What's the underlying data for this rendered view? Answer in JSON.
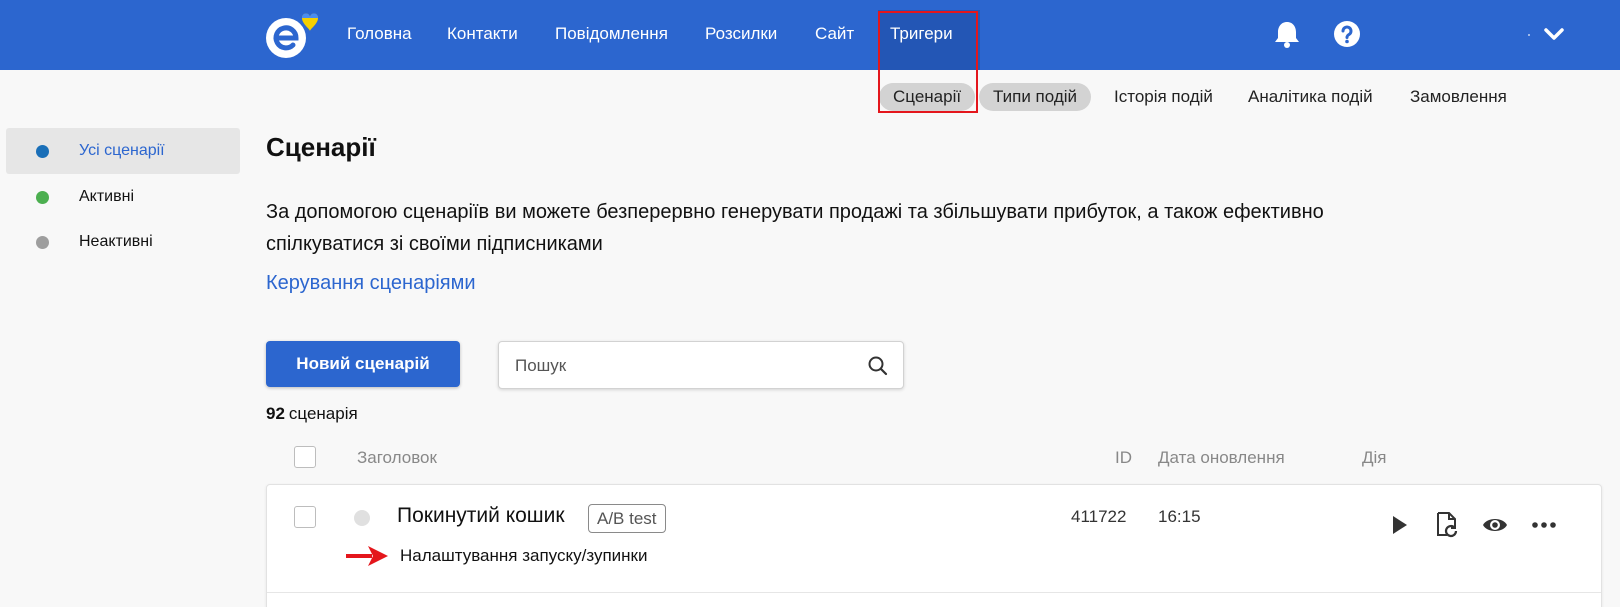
{
  "header": {
    "nav": [
      {
        "label": "Головна"
      },
      {
        "label": "Контакти"
      },
      {
        "label": "Повідомлення"
      },
      {
        "label": "Розсилки"
      },
      {
        "label": "Сайт"
      },
      {
        "label": "Тригери",
        "active": true
      }
    ],
    "icons": [
      "bell-icon",
      "help-icon",
      "chevron-down-icon"
    ],
    "accent_color": "#2c66cf"
  },
  "subnav": {
    "tabs": [
      {
        "label": "Сценарії",
        "active": true
      },
      {
        "label": "Типи подій"
      },
      {
        "label": "Історія подій"
      },
      {
        "label": "Аналітика подій"
      },
      {
        "label": "Замовлення"
      }
    ]
  },
  "sidebar": {
    "items": [
      {
        "label": "Усі сценарії",
        "active": true,
        "dot_color": "#1a6fb8"
      },
      {
        "label": "Активні",
        "dot_color": "#4caf50"
      },
      {
        "label": "Неактивні",
        "dot_color": "#9e9e9e"
      }
    ]
  },
  "main": {
    "title": "Сценарії",
    "description": "За допомогою сценаріїв ви можете безперервно генерувати продажі та збільшувати прибуток, а також ефективно спілкуватися зі своїми підписниками",
    "manage_link": "Керування сценаріями",
    "new_button": "Новий сценарій",
    "search_placeholder": "Пошук",
    "count_number": "92",
    "count_label": "сценарія"
  },
  "table": {
    "columns": {
      "title": "Заголовок",
      "id": "ID",
      "date": "Дата оновлення",
      "action": "Дія"
    },
    "rows": [
      {
        "title": "Покинутий кошик",
        "badge": "A/B test",
        "id": "411722",
        "date": "16:15"
      }
    ],
    "row_actions": [
      "play-icon",
      "restart-icon",
      "eye-icon",
      "more-icon"
    ]
  },
  "annotation": {
    "text": "Налаштування запуску/зупинки",
    "highlight_color": "#e4161c"
  }
}
